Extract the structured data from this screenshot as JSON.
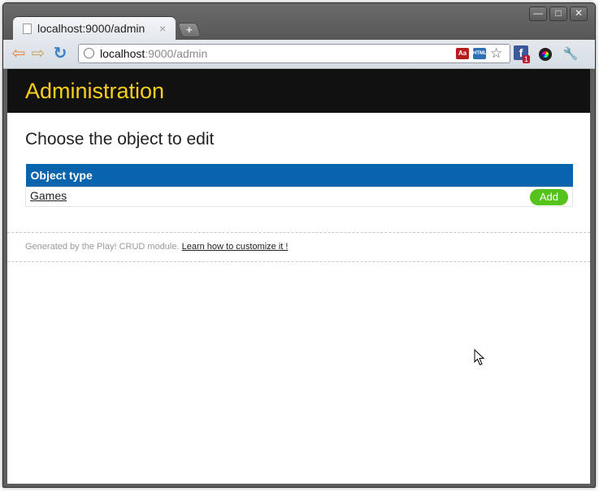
{
  "browser": {
    "tab": {
      "title": "localhost:9000/admin",
      "close": "×"
    },
    "newtab_symbol": "+",
    "window_buttons": {
      "minimize": "—",
      "maximize": "□",
      "close": "✕"
    },
    "nav": {
      "back": "⇦",
      "forward": "⇨",
      "reload": "↻"
    },
    "address": {
      "host": "localhost",
      "path": ":9000/admin"
    },
    "extensions": {
      "dict_label": "Aa",
      "html_label": "HTML",
      "facebook_badge": "1",
      "facebook_letter": "f"
    },
    "star": "☆",
    "wrench": "🔧",
    "icons": [
      "page-icon",
      "back-arrow-icon",
      "forward-arrow-icon",
      "reload-icon",
      "globe-icon",
      "dictionary-icon",
      "html-validator-icon",
      "bookmark-star-icon",
      "facebook-icon",
      "color-wheel-icon",
      "wrench-icon",
      "mouse-cursor-icon"
    ]
  },
  "page": {
    "header_title": "Administration",
    "subtitle": "Choose the object to edit",
    "table": {
      "column_header": "Object type",
      "rows": [
        {
          "name": "Games",
          "action": "Add"
        }
      ]
    },
    "footer": {
      "text": "Generated by the Play! CRUD module.",
      "link": "Learn how to customize it !"
    }
  },
  "colors": {
    "header_bg": "#111111",
    "header_title": "#f8cf1b",
    "table_header_bg": "#0a63ad",
    "add_button_bg": "#55c31c"
  }
}
